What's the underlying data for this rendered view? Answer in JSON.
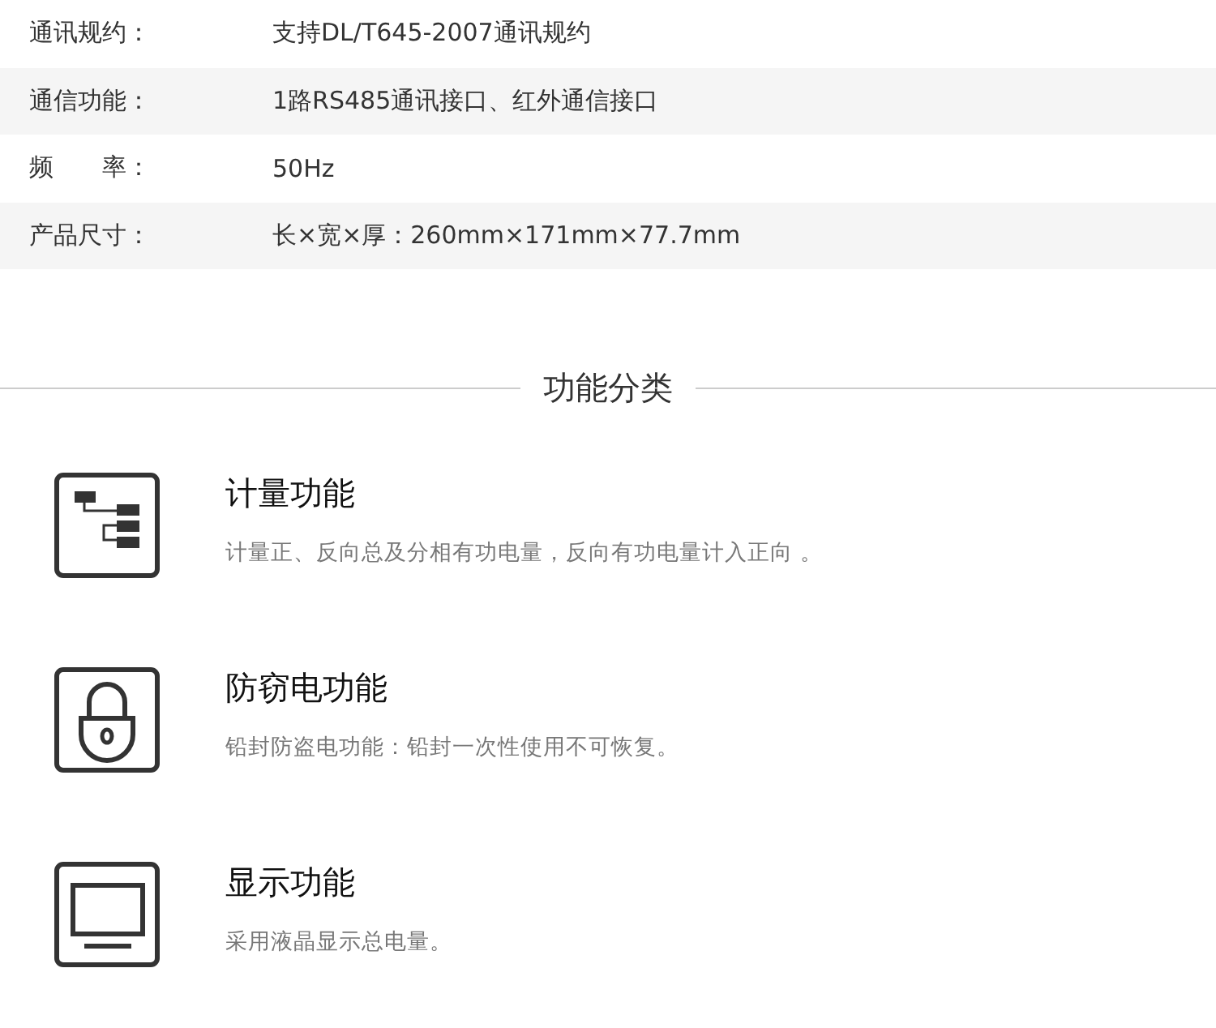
{
  "specs": [
    {
      "label": "通讯规约：",
      "value": "支持DL/T645-2007通讯规约"
    },
    {
      "label": "通信功能：",
      "value": "1路RS485通讯接口、红外通信接口"
    },
    {
      "label": "频　　率：",
      "value": "50Hz"
    },
    {
      "label": "产品尺寸：",
      "value": "长×宽×厚：260mm×171mm×77.7mm"
    }
  ],
  "section_title": "功能分类",
  "features": [
    {
      "kind": "tree",
      "title": "计量功能",
      "description": "计量正、反向总及分相有功电量，反向有功电量计入正向 。"
    },
    {
      "kind": "lock",
      "title": "防窃电功能",
      "description": "铅封防盗电功能：铅封一次性使用不可恢复。"
    },
    {
      "kind": "monitor",
      "title": "显示功能",
      "description": "采用液晶显示总电量。"
    }
  ]
}
